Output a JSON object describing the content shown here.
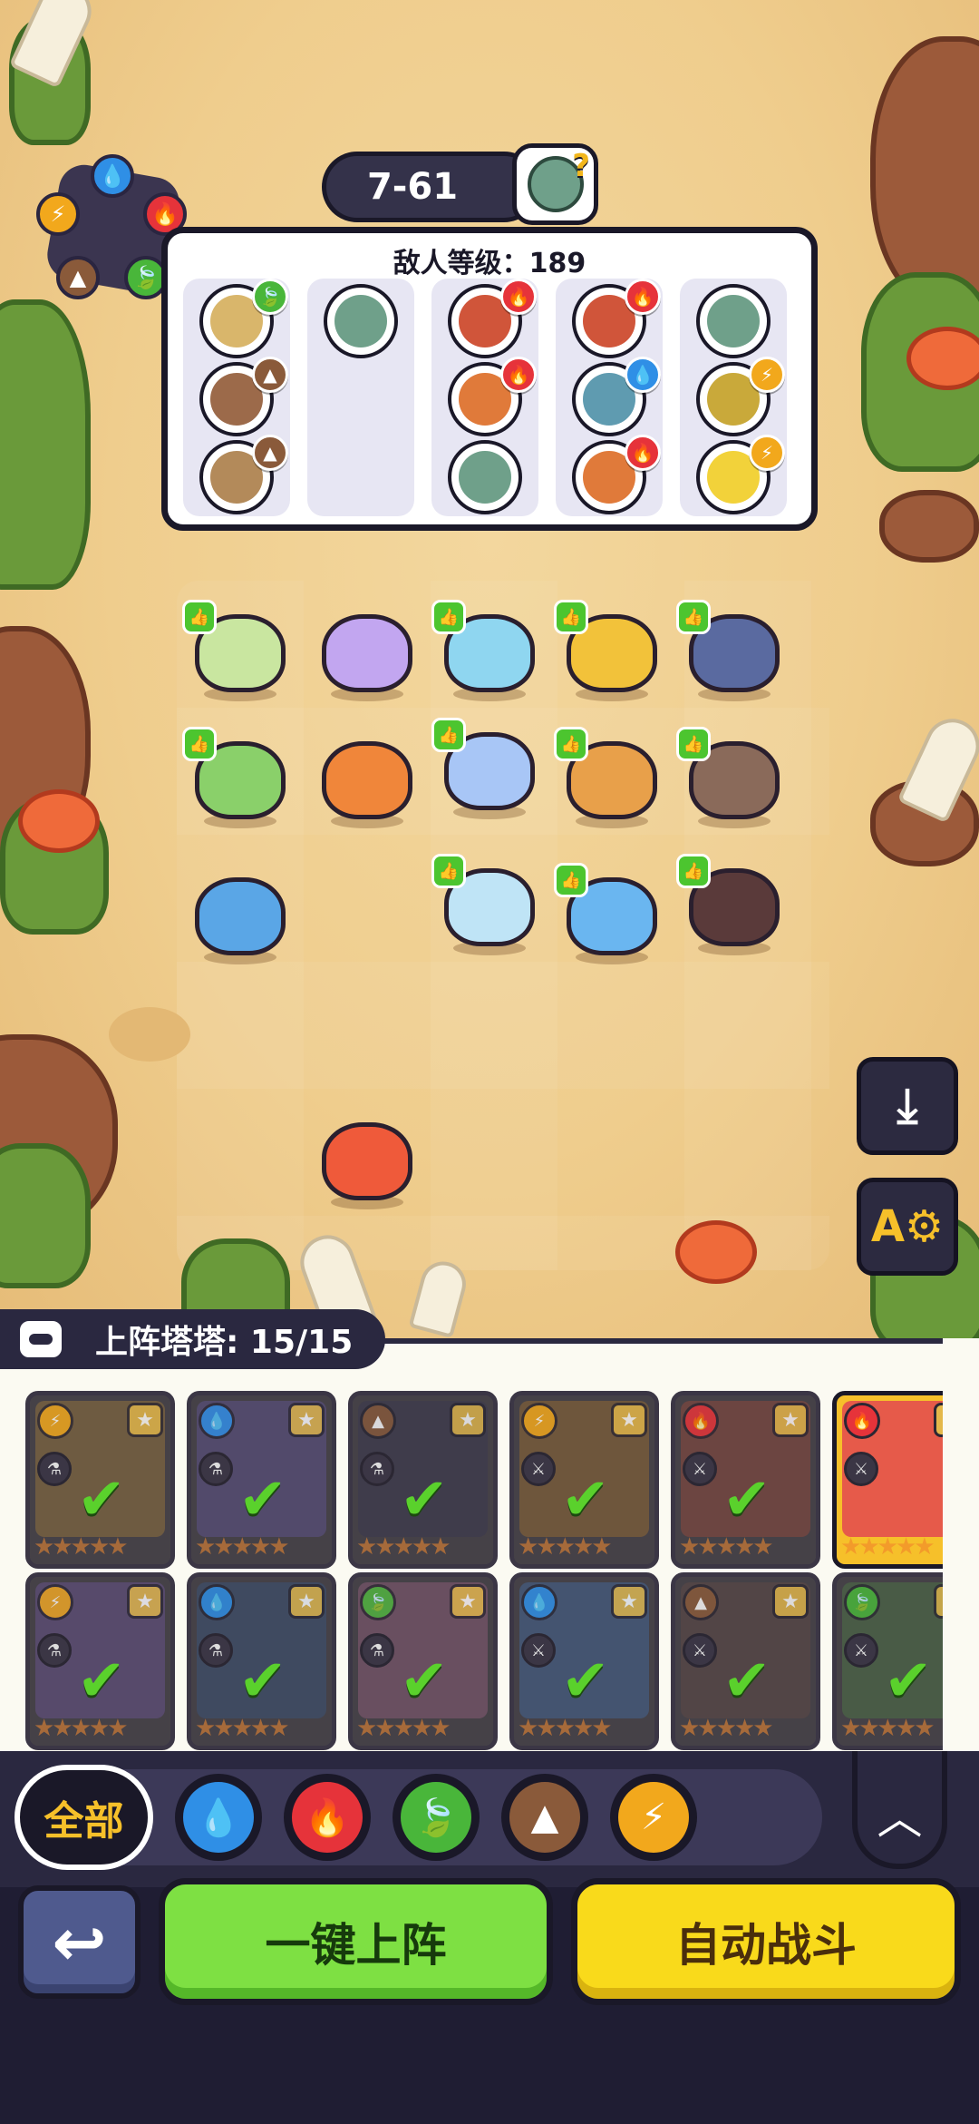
{
  "stage": {
    "level_label": "7-61",
    "boss_hint": "?"
  },
  "enemy_panel": {
    "title": "敌人等级：189",
    "columns": [
      {
        "enemies": [
          {
            "color": "#d9b66b",
            "element": "nature"
          },
          {
            "color": "#9c6a4a",
            "element": "earth"
          },
          {
            "color": "#b38a5a",
            "element": "earth"
          }
        ]
      },
      {
        "enemies": [
          {
            "color": "#6fa08a",
            "element": ""
          }
        ]
      },
      {
        "enemies": [
          {
            "color": "#d0553a",
            "element": "fire"
          },
          {
            "color": "#e07a3a",
            "element": "fire"
          },
          {
            "color": "#6fa08a",
            "element": ""
          }
        ]
      },
      {
        "enemies": [
          {
            "color": "#d0553a",
            "element": "fire"
          },
          {
            "color": "#5f9bb0",
            "element": "water"
          },
          {
            "color": "#e07a3a",
            "element": "fire"
          }
        ]
      },
      {
        "enemies": [
          {
            "color": "#6fa08a",
            "element": ""
          },
          {
            "color": "#c9a93a",
            "element": "thunder"
          },
          {
            "color": "#f2d23a",
            "element": "thunder"
          }
        ]
      }
    ]
  },
  "element_icons": {
    "water": {
      "glyph": "💧",
      "color": "#2f8fe6"
    },
    "fire": {
      "glyph": "🔥",
      "color": "#e6333a"
    },
    "nature": {
      "glyph": "🍃",
      "color": "#49b63a"
    },
    "earth": {
      "glyph": "▲",
      "color": "#8a5a3a"
    },
    "thunder": {
      "glyph": "⚡",
      "color": "#f2a81c"
    }
  },
  "roster": {
    "header": "上阵塔塔: 15/15",
    "cards": [
      {
        "art": "#e6b04a",
        "element": "thunder",
        "role": "⚗",
        "active": false
      },
      {
        "art": "#8a7ad6",
        "element": "water",
        "role": "⚗",
        "active": false
      },
      {
        "art": "#4a4a6a",
        "element": "earth",
        "role": "⚗",
        "active": false
      },
      {
        "art": "#e6a03a",
        "element": "thunder",
        "role": "⚔",
        "active": false
      },
      {
        "art": "#e06a4a",
        "element": "fire",
        "role": "⚔",
        "active": false
      },
      {
        "art": "#e65a4a",
        "element": "fire",
        "role": "⚔",
        "active": true
      },
      {
        "art": "#9a7ad6",
        "element": "thunder",
        "role": "⚗",
        "active": false
      },
      {
        "art": "#4a7ab0",
        "element": "water",
        "role": "⚗",
        "active": false
      },
      {
        "art": "#d68ab0",
        "element": "nature",
        "role": "⚗",
        "active": false
      },
      {
        "art": "#5a9ae6",
        "element": "water",
        "role": "⚔",
        "active": false
      },
      {
        "art": "#8a6a5a",
        "element": "earth",
        "role": "⚔",
        "active": false
      },
      {
        "art": "#6ab05a",
        "element": "nature",
        "role": "⚔",
        "active": false
      }
    ],
    "star_row": "★★★★★"
  },
  "filters": {
    "all_label": "全部",
    "items": [
      "water",
      "fire",
      "nature",
      "earth",
      "thunder"
    ]
  },
  "actions": {
    "deploy_label": "一键上阵",
    "auto_label": "自动战斗"
  }
}
